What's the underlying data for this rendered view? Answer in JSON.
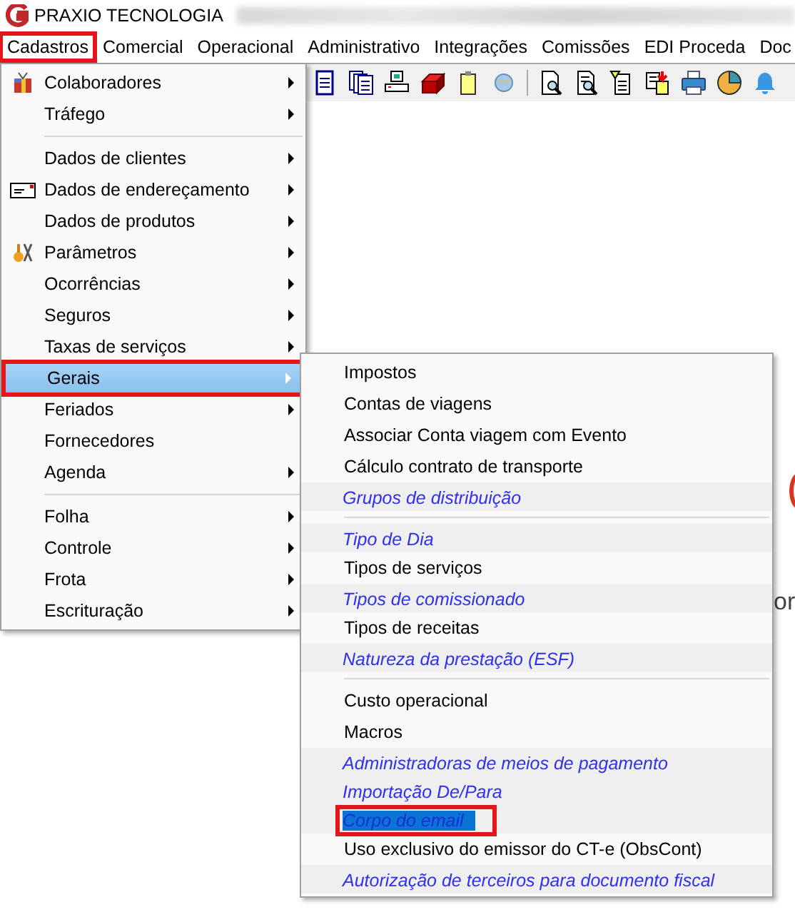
{
  "window": {
    "title": "PRAXIO TECNOLOGIA"
  },
  "menu_bar": [
    {
      "label": "Cadastros",
      "annotated": true
    },
    {
      "label": "Comercial",
      "annotated": false
    },
    {
      "label": "Operacional",
      "annotated": false
    },
    {
      "label": "Administrativo",
      "annotated": false
    },
    {
      "label": "Integrações",
      "annotated": false
    },
    {
      "label": "Comissões",
      "annotated": false
    },
    {
      "label": "EDI Proceda",
      "annotated": false
    },
    {
      "label": "Doc",
      "annotated": false
    }
  ],
  "cadastros_menu": [
    {
      "kind": "item",
      "label": "Colaboradores",
      "submenu": true,
      "selected": false,
      "annotated": false
    },
    {
      "kind": "item",
      "label": "Tráfego",
      "submenu": true,
      "selected": false,
      "annotated": false
    },
    {
      "kind": "separator"
    },
    {
      "kind": "item",
      "label": "Dados de clientes",
      "submenu": true,
      "selected": false,
      "annotated": false
    },
    {
      "kind": "item",
      "label": "Dados de endereçamento",
      "submenu": true,
      "selected": false,
      "annotated": false
    },
    {
      "kind": "item",
      "label": "Dados de produtos",
      "submenu": true,
      "selected": false,
      "annotated": false
    },
    {
      "kind": "item",
      "label": "Parâmetros",
      "submenu": true,
      "selected": false,
      "annotated": false
    },
    {
      "kind": "item",
      "label": "Ocorrências",
      "submenu": true,
      "selected": false,
      "annotated": false
    },
    {
      "kind": "item",
      "label": "Seguros",
      "submenu": true,
      "selected": false,
      "annotated": false
    },
    {
      "kind": "item",
      "label": "Taxas de serviços",
      "submenu": true,
      "selected": false,
      "annotated": false
    },
    {
      "kind": "item",
      "label": "Gerais",
      "submenu": true,
      "selected": true,
      "annotated": true
    },
    {
      "kind": "item",
      "label": "Feriados",
      "submenu": true,
      "selected": false,
      "annotated": false
    },
    {
      "kind": "item",
      "label": "Fornecedores",
      "submenu": false,
      "selected": false,
      "annotated": false
    },
    {
      "kind": "item",
      "label": "Agenda",
      "submenu": true,
      "selected": false,
      "annotated": false
    },
    {
      "kind": "separator"
    },
    {
      "kind": "item",
      "label": "Folha",
      "submenu": true,
      "selected": false,
      "annotated": false
    },
    {
      "kind": "item",
      "label": "Controle",
      "submenu": true,
      "selected": false,
      "annotated": false
    },
    {
      "kind": "item",
      "label": "Frota",
      "submenu": true,
      "selected": false,
      "annotated": false
    },
    {
      "kind": "item",
      "label": "Escrituração",
      "submenu": true,
      "selected": false,
      "annotated": false
    }
  ],
  "gerais_menu": [
    {
      "kind": "item",
      "label": "Impostos",
      "selected": false,
      "annotated": false
    },
    {
      "kind": "item",
      "label": "Contas de viagens",
      "selected": false,
      "annotated": false
    },
    {
      "kind": "item",
      "label": "Associar Conta viagem com Evento",
      "selected": false,
      "annotated": false
    },
    {
      "kind": "item",
      "label": "Cálculo contrato de transporte",
      "selected": false,
      "annotated": false
    },
    {
      "kind": "link",
      "label": "Grupos de distribuição",
      "selected": false,
      "annotated": false
    },
    {
      "kind": "separator"
    },
    {
      "kind": "link",
      "label": "Tipo de Dia",
      "selected": false,
      "annotated": false
    },
    {
      "kind": "item",
      "label": "Tipos de serviços",
      "selected": false,
      "annotated": false
    },
    {
      "kind": "link",
      "label": "Tipos de comissionado",
      "selected": false,
      "annotated": false
    },
    {
      "kind": "item",
      "label": "Tipos de receitas",
      "selected": false,
      "annotated": false
    },
    {
      "kind": "link",
      "label": "Natureza da prestação (ESF)",
      "selected": false,
      "annotated": false
    },
    {
      "kind": "separator"
    },
    {
      "kind": "item",
      "label": "Custo operacional",
      "selected": false,
      "annotated": false
    },
    {
      "kind": "item",
      "label": "Macros",
      "selected": false,
      "annotated": false
    },
    {
      "kind": "link",
      "label": "Administradoras de meios de pagamento",
      "selected": false,
      "annotated": false
    },
    {
      "kind": "link",
      "label": "Importação De/Para",
      "selected": false,
      "annotated": false
    },
    {
      "kind": "link",
      "label": "Corpo do email",
      "selected": true,
      "annotated": true
    },
    {
      "kind": "item",
      "label": "Uso exclusivo do emissor do CT-e (ObsCont)",
      "selected": false,
      "annotated": false
    },
    {
      "kind": "link",
      "label": "Autorização de terceiros para documento fiscal",
      "selected": false,
      "annotated": false
    }
  ],
  "background_text": "or"
}
